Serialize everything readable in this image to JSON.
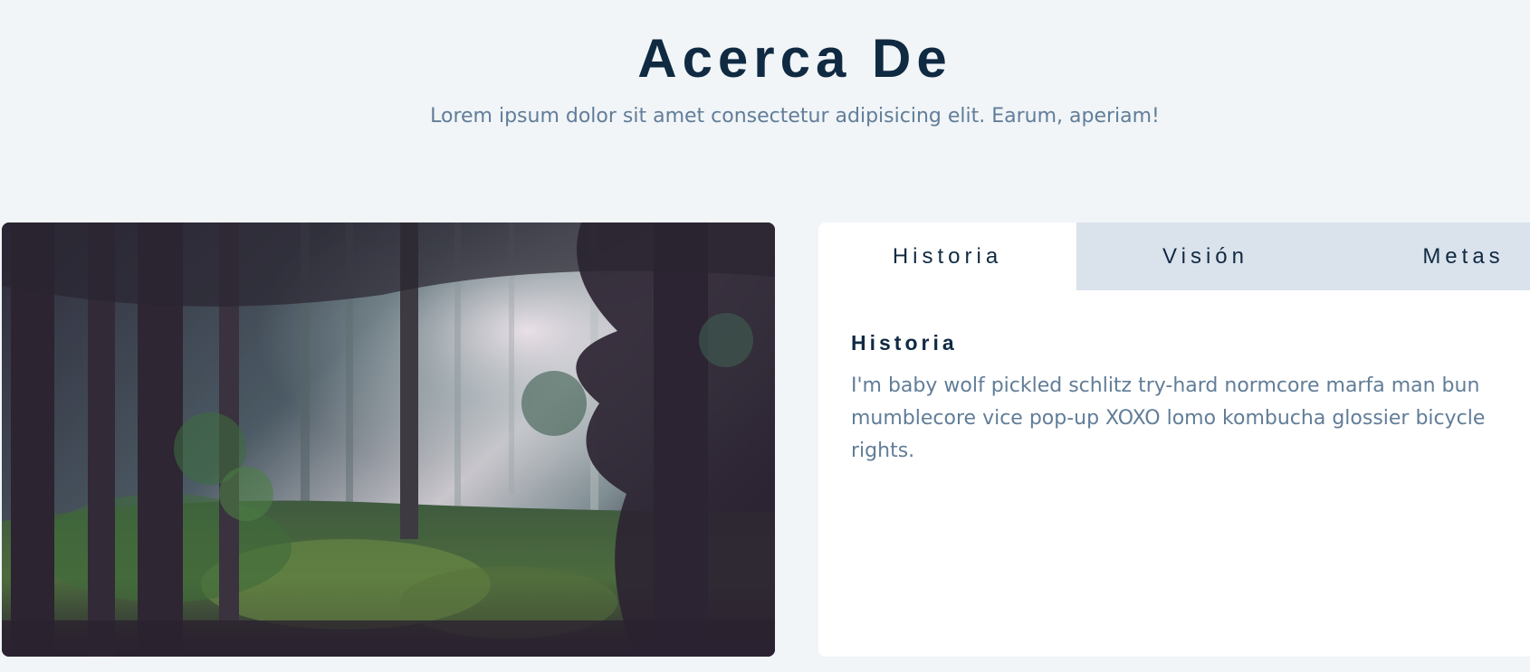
{
  "header": {
    "title": "Acerca De",
    "subtitle": "Lorem ipsum dolor sit amet consectetur adipisicing elit. Earum, aperiam!"
  },
  "tabs": [
    {
      "label": "Historia",
      "active": true
    },
    {
      "label": "Visión",
      "active": false
    },
    {
      "label": "Metas",
      "active": false
    }
  ],
  "content": {
    "title": "Historia",
    "text": "I'm baby wolf pickled schlitz try-hard normcore marfa man bun mumblecore vice pop-up XOXO lomo kombucha glossier bicycle rights."
  },
  "image": {
    "subject": "forest-photo"
  },
  "colors": {
    "background": "#f1f5f8",
    "title": "#102a42",
    "body_text": "#617d98",
    "inactive_tab": "#dae2ec",
    "active_tab": "#ffffff"
  }
}
